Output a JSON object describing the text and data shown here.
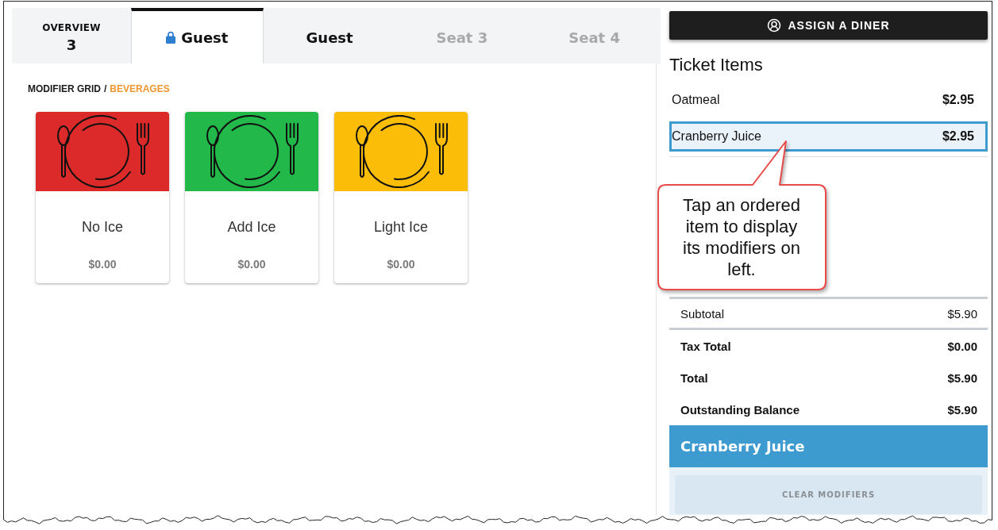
{
  "tabs": [
    {
      "kind": "overview",
      "label": "OVERVIEW",
      "count": "3",
      "selected": false,
      "locked": false,
      "disabled": false
    },
    {
      "kind": "seat",
      "label": "Guest",
      "selected": true,
      "locked": true,
      "disabled": false
    },
    {
      "kind": "seat",
      "label": "Guest",
      "selected": false,
      "locked": false,
      "disabled": false
    },
    {
      "kind": "seat",
      "label": "Seat 3",
      "selected": false,
      "locked": false,
      "disabled": true
    },
    {
      "kind": "seat",
      "label": "Seat 4",
      "selected": false,
      "locked": false,
      "disabled": true
    }
  ],
  "breadcrumb": {
    "items": [
      {
        "label": "MODIFIER GRID",
        "current": false
      },
      {
        "label": "BEVERAGES",
        "current": true
      }
    ],
    "separator": "/"
  },
  "modifiers": [
    {
      "name": "No Ice",
      "price": "$0.00",
      "color": "#dc2a2a"
    },
    {
      "name": "Add Ice",
      "price": "$0.00",
      "color": "#22b84a"
    },
    {
      "name": "Light Ice",
      "price": "$0.00",
      "color": "#fbbd08"
    }
  ],
  "assign_button": {
    "label": "ASSIGN A DINER"
  },
  "ticket": {
    "title": "Ticket Items",
    "items": [
      {
        "name": "Oatmeal",
        "price": "$2.95",
        "selected": false
      },
      {
        "name": "Cranberry Juice",
        "price": "$2.95",
        "selected": true
      }
    ]
  },
  "totals": [
    {
      "kind": "subtotal",
      "label": "Subtotal",
      "value": "$5.90"
    },
    {
      "kind": "total",
      "label": "Tax Total",
      "value": "$0.00"
    },
    {
      "kind": "total",
      "label": "Total",
      "value": "$5.90"
    },
    {
      "kind": "total",
      "label": "Outstanding Balance",
      "value": "$5.90"
    }
  ],
  "modifier_panel": {
    "title": "Cranberry Juice",
    "clear_button": "CLEAR MODIFIERS"
  },
  "callout": {
    "text": "Tap an ordered item to display its modifiers on left."
  }
}
